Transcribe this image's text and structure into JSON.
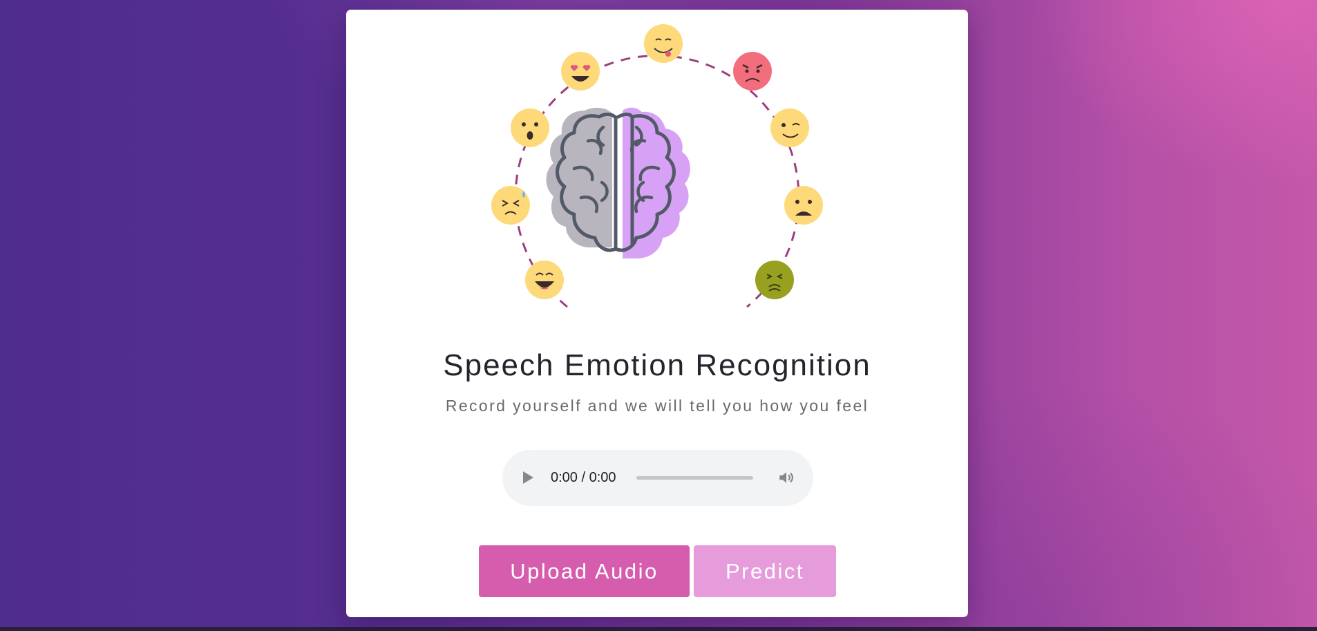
{
  "page": {
    "title": "Speech Emotion Recognition",
    "subtitle": "Record yourself and we will tell you how you feel"
  },
  "audio_player": {
    "time": "0:00 / 0:00",
    "progress": 0
  },
  "buttons": {
    "upload_label": "Upload Audio",
    "predict_label": "Predict"
  },
  "colors": {
    "accent": "#d65cad",
    "accent_disabled": "#e69cdb",
    "arc": "#9b3f7d",
    "emoji_yellow": "#fdd97a",
    "emoji_angry": "#f26e7c",
    "emoji_sick": "#98a020",
    "brain_left": "#b8b5be",
    "brain_right": "#d7a2f5",
    "brain_outline": "#535a67"
  },
  "illustration": {
    "icons": [
      "yum-emoji-icon",
      "heart-eyes-emoji-icon",
      "angry-emoji-icon",
      "surprised-emoji-icon",
      "wink-emoji-icon",
      "anxious-emoji-icon",
      "sad-emoji-icon",
      "laughing-emoji-icon",
      "nauseated-emoji-icon",
      "brain-icon"
    ]
  }
}
